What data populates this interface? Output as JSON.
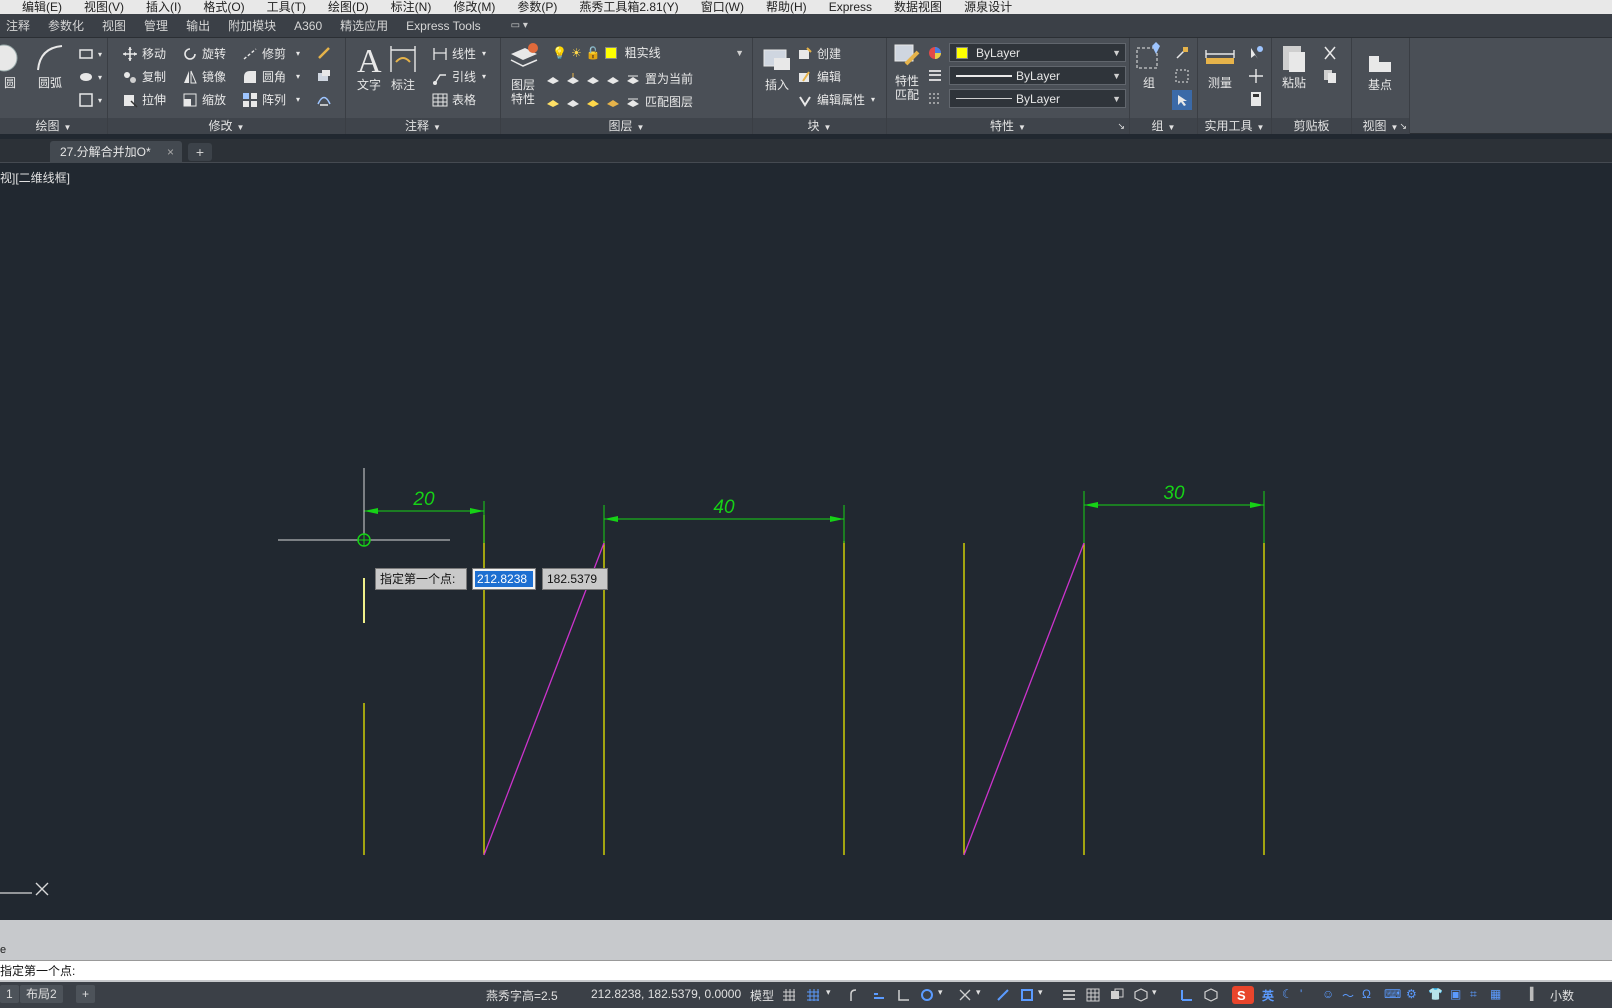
{
  "menu": [
    "编辑(E)",
    "视图(V)",
    "插入(I)",
    "格式(O)",
    "工具(T)",
    "绘图(D)",
    "标注(N)",
    "修改(M)",
    "参数(P)",
    "燕秀工具箱2.81(Y)",
    "窗口(W)",
    "帮助(H)",
    "Express",
    "数据视图",
    "源泉设计"
  ],
  "ribbon_tabs": [
    "注释",
    "参数化",
    "视图",
    "管理",
    "输出",
    "附加模块",
    "A360",
    "精选应用",
    "Express Tools"
  ],
  "draw_panel": {
    "circle": "圆",
    "arc": "圆弧",
    "title": "绘图"
  },
  "modify_panel": {
    "title": "修改",
    "move": "移动",
    "rotate": "旋转",
    "trim": "修剪",
    "copy": "复制",
    "mirror": "镜像",
    "fillet": "圆角",
    "stretch": "拉伸",
    "scale": "缩放",
    "array": "阵列"
  },
  "annotation_panel": {
    "title": "注释",
    "text": "文字",
    "dim": "标注",
    "linear": "线性",
    "leader": "引线",
    "table": "表格"
  },
  "layer_panel": {
    "title": "图层",
    "layer_props_1": "图层",
    "layer_props_2": "特性",
    "current_layer": "粗实线",
    "make_current": "置为当前",
    "match_layer": "匹配图层"
  },
  "block_panel": {
    "title": "块",
    "insert": "插入",
    "create": "创建",
    "edit": "编辑",
    "edit_attr": "编辑属性"
  },
  "properties_panel": {
    "title": "特性",
    "match_1": "特性",
    "match_2": "匹配",
    "color": "ByLayer",
    "lineweight": "ByLayer",
    "linetype": "ByLayer"
  },
  "groups_panel": {
    "title": "组",
    "group": "组"
  },
  "utilities_panel": {
    "title": "实用工具",
    "measure": "测量"
  },
  "clipboard_panel": {
    "title": "剪贴板",
    "paste": "粘贴"
  },
  "view_panel": {
    "title": "视图",
    "base": "基点"
  },
  "doc_tab": {
    "name": "27.分解合并加O*",
    "close": "×",
    "new": "+"
  },
  "viewport": {
    "label": "视][二维线框]",
    "dims": [
      "20",
      "40",
      "30"
    ],
    "prompt": "指定第一个点:",
    "x_value": "212.8238",
    "y_value": "182.5379"
  },
  "command": {
    "history": "e",
    "current": "指定第一个点:"
  },
  "statusbar": {
    "layout_tab_1": "1",
    "layout_tab_2": "布局2",
    "add": "+",
    "text_height": "燕秀字高=2.5",
    "coords": "212.8238, 182.5379, 0.0000",
    "model": "模型",
    "ime": "英",
    "units": "小数"
  },
  "colors": {
    "background": "#212830",
    "yellow_line": "#e6e600",
    "magenta_line": "#cc33cc",
    "dim_green": "#16d216",
    "crosshair": "#d8d8d8"
  }
}
